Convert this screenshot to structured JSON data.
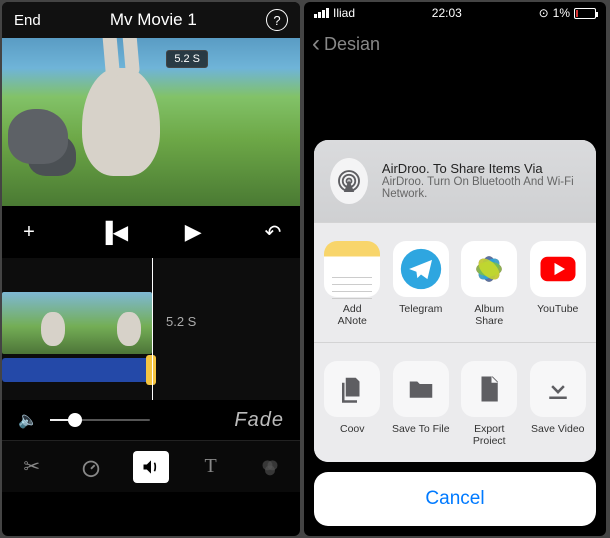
{
  "left": {
    "header": {
      "end": "End",
      "title": "Mv Movie 1",
      "help": "?"
    },
    "preview": {
      "timeBadge": "5.2 S"
    },
    "transport": {
      "add": "+",
      "prev": "▐◀",
      "play": "▶",
      "undo": "↶"
    },
    "timeline": {
      "timeLabel": "5.2 S"
    },
    "volume": {
      "fadeLabel": "Fade"
    },
    "toolbar": {
      "cut": "✂",
      "speed": "◔",
      "audio": "🔊",
      "text": "T",
      "filter": "●"
    }
  },
  "right": {
    "status": {
      "carrier": "Iliad",
      "time": "22:03",
      "battery": "1%"
    },
    "nav": {
      "back": "Desian"
    },
    "airdrop": {
      "line1": "AirDroo. To Share Items Via",
      "line2": "AirDroo. Turn On Bluetooth And Wi-Fi Network."
    },
    "apps": [
      {
        "name": "Add\nANote"
      },
      {
        "name": "Telegram"
      },
      {
        "name": "Album\nShare"
      },
      {
        "name": "YouTube"
      }
    ],
    "actions": [
      {
        "name": "Coov"
      },
      {
        "name": "Save To File"
      },
      {
        "name": "Export\nProiect"
      },
      {
        "name": "Save Video"
      }
    ],
    "cancel": "Cancel"
  }
}
